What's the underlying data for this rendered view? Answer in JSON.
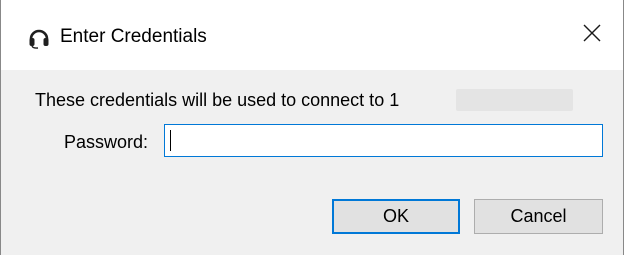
{
  "window": {
    "title": "Enter Credentials",
    "icon": "headset-icon",
    "close_icon": "close-icon"
  },
  "message": {
    "text": "These credentials will be used to connect to 1"
  },
  "password": {
    "label": "Password:",
    "value": ""
  },
  "buttons": {
    "ok_label": "OK",
    "cancel_label": "Cancel"
  },
  "colors": {
    "accent": "#0078d7",
    "dialog_background": "#f0f0f0",
    "button_background": "#e1e1e1"
  }
}
